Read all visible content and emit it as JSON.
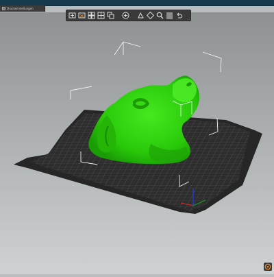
{
  "window": {
    "tab_label": "Druckeinstellungen"
  },
  "toolbar": {
    "buttons": [
      {
        "name": "add-icon"
      },
      {
        "name": "delete-icon"
      },
      {
        "name": "delete-all-icon"
      },
      {
        "name": "arrange-icon"
      },
      {
        "name": "copy-icon"
      },
      {
        "name": "paste-icon"
      },
      {
        "name": "add-instance-icon"
      },
      {
        "name": "remove-instance-icon"
      },
      {
        "name": "split-objects-icon"
      },
      {
        "name": "split-parts-icon"
      },
      {
        "name": "search-icon"
      },
      {
        "name": "layers-editing-icon"
      },
      {
        "name": "undo-icon"
      }
    ]
  },
  "scene": {
    "model_color": "#2ed60c",
    "bed_color": "#2b2b2b",
    "grid_color": "#5a5a5a",
    "background_top": "#8d9192",
    "background_bottom": "#cfd2d3"
  }
}
